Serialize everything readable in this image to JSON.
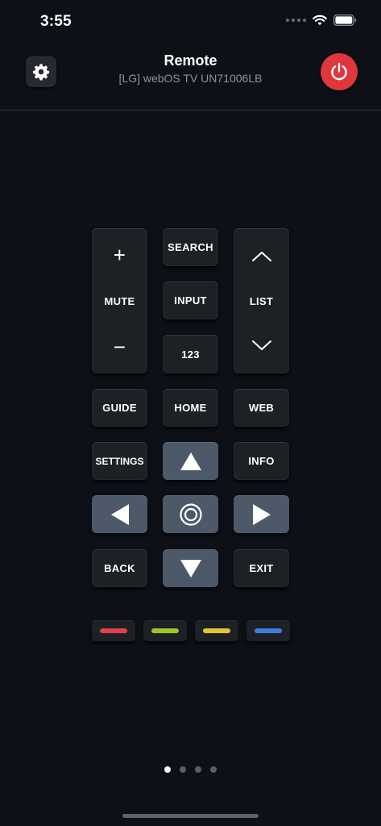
{
  "status_bar": {
    "time": "3:55"
  },
  "header": {
    "title": "Remote",
    "subtitle": "[LG] webOS TV UN71006LB"
  },
  "icons": {
    "settings": "gear-icon",
    "power": "power-icon",
    "wifi": "wifi-icon",
    "battery": "battery-icon"
  },
  "colors": {
    "background": "#0d1117",
    "button": "#1d2025",
    "button_highlight": "#4d5869",
    "power": "#e0373d"
  },
  "remote": {
    "volume": {
      "up": "+",
      "label": "MUTE",
      "down": "−"
    },
    "search": "SEARCH",
    "input": "INPUT",
    "numbers": "123",
    "channel": {
      "label": "LIST"
    },
    "guide": "GUIDE",
    "home": "HOME",
    "web": "WEB",
    "settings": "SETTINGS",
    "info": "INFO",
    "back": "BACK",
    "exit": "EXIT"
  },
  "color_keys": [
    {
      "name": "red",
      "color": "#e0414a"
    },
    {
      "name": "green",
      "color": "#9cc62c"
    },
    {
      "name": "yellow",
      "color": "#e6c23a"
    },
    {
      "name": "blue",
      "color": "#3d7ee0"
    }
  ],
  "pager": {
    "count": 4,
    "active_index": 0
  }
}
